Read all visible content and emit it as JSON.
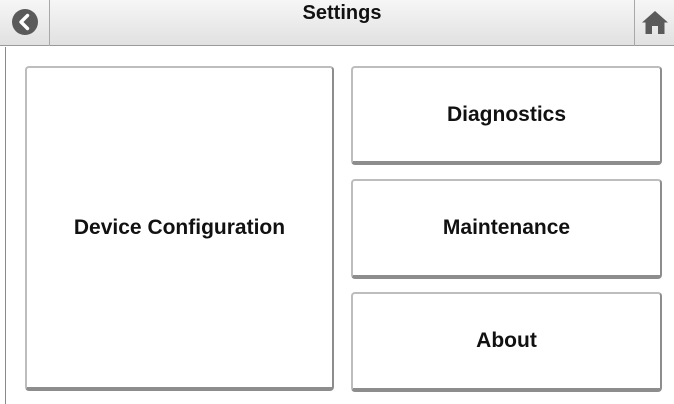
{
  "header": {
    "title": "Settings",
    "back_icon": "chevron-left-circle-icon",
    "home_icon": "home-icon"
  },
  "tiles": {
    "device_configuration": "Device Configuration",
    "diagnostics": "Diagnostics",
    "maintenance": "Maintenance",
    "about": "About"
  },
  "colors": {
    "header_bg": "#e8e8e8",
    "icon_dark": "#5a5a5a",
    "tile_border": "#bdbdbd",
    "tile_shadow": "#8d8d8d"
  }
}
